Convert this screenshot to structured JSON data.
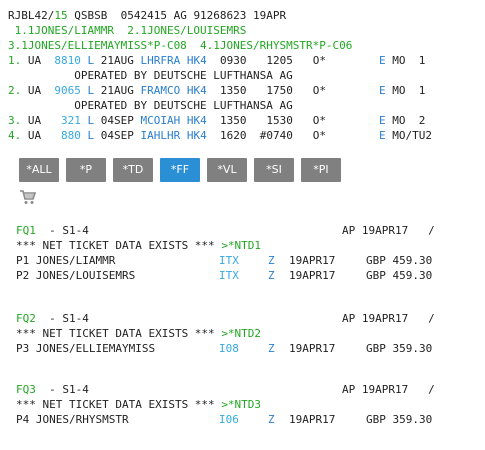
{
  "itinerary": {
    "header": {
      "rec": "RJBL42/",
      "agent": "15",
      "rest": " QSBSB  0542415 AG 91268623 19APR"
    },
    "names_line1": " 1.1JONES/LIAMMR  2.1JONES/LOUISEMRS",
    "names_line2": "3.1JONES/ELLIEMAYMISS*P-C08  4.1JONES/RHYSMSTR*P-C06",
    "segments": [
      {
        "num": "1.",
        "carrier": "UA",
        "flight": "8810",
        "cls": "L",
        "date": "21AUG",
        "route": "LHRFRA",
        "status": "HK4",
        "dep": "0930",
        "arr": "1205",
        "flag": "O*",
        "e": "E",
        "day": "MO",
        "n": "1",
        "operated": "OPERATED BY DEUTSCHE LUFTHANSA AG"
      },
      {
        "num": "2.",
        "carrier": "UA",
        "flight": "9065",
        "cls": "L",
        "date": "21AUG",
        "route": "FRAMCO",
        "status": "HK4",
        "dep": "1350",
        "arr": "1750",
        "flag": "O*",
        "e": "E",
        "day": "MO",
        "n": "1",
        "operated": "OPERATED BY DEUTSCHE LUFTHANSA AG"
      },
      {
        "num": "3.",
        "carrier": "UA",
        "flight": "321",
        "cls": "L",
        "date": "04SEP",
        "route": "MCOIAH",
        "status": "HK4",
        "dep": "1350",
        "arr": "1530",
        "flag": "O*",
        "e": "E",
        "day": "MO",
        "n": "2"
      },
      {
        "num": "4.",
        "carrier": "UA",
        "flight": "880",
        "cls": "L",
        "date": "04SEP",
        "route": "IAHLHR",
        "status": "HK4",
        "dep": "1620",
        "arr": "#0740",
        "flag": "O*",
        "e": "E",
        "day": "MO/TU2",
        "n": ""
      }
    ]
  },
  "buttons": [
    {
      "label": "*ALL",
      "active": false
    },
    {
      "label": "*P",
      "active": false
    },
    {
      "label": "*TD",
      "active": false
    },
    {
      "label": "*FF",
      "active": true
    },
    {
      "label": "*VL",
      "active": false
    },
    {
      "label": "*SI",
      "active": false
    },
    {
      "label": "*PI",
      "active": false
    }
  ],
  "cart_icon": "shopping-cart-icon",
  "fare_quotes": [
    {
      "fq": "FQ1",
      "segs": "- S1-4",
      "ap": "AP 19APR17   /",
      "net_text": "*** NET TICKET DATA EXISTS *** ",
      "net_link": ">*NTD1",
      "pax": [
        {
          "name": "P1 JONES/LIAMMR",
          "type": "ITX",
          "z": "Z",
          "date": "19APR17",
          "fare": "GBP 459.30"
        },
        {
          "name": "P2 JONES/LOUISEMRS",
          "type": "ITX",
          "z": "Z",
          "date": "19APR17",
          "fare": "GBP 459.30"
        }
      ]
    },
    {
      "fq": "FQ2",
      "segs": "- S1-4",
      "ap": "AP 19APR17   /",
      "net_text": "*** NET TICKET DATA EXISTS *** ",
      "net_link": ">*NTD2",
      "pax": [
        {
          "name": "P3 JONES/ELLIEMAYMISS",
          "type": "I08",
          "z": "Z",
          "date": "19APR17",
          "fare": "GBP 359.30"
        }
      ]
    },
    {
      "fq": "FQ3",
      "segs": "- S1-4",
      "ap": "AP 19APR17   /",
      "net_text": "*** NET TICKET DATA EXISTS *** ",
      "net_link": ">*NTD3",
      "pax": [
        {
          "name": "P4 JONES/RHYSMSTR",
          "type": "I06",
          "z": "Z",
          "date": "19APR17",
          "fare": "GBP 359.30"
        }
      ]
    }
  ],
  "colors": {
    "green": "#22a722",
    "blue": "#2a7fd0",
    "light_blue": "#34a9e0",
    "button_gray": "#808080",
    "button_active": "#2b8fd6"
  }
}
